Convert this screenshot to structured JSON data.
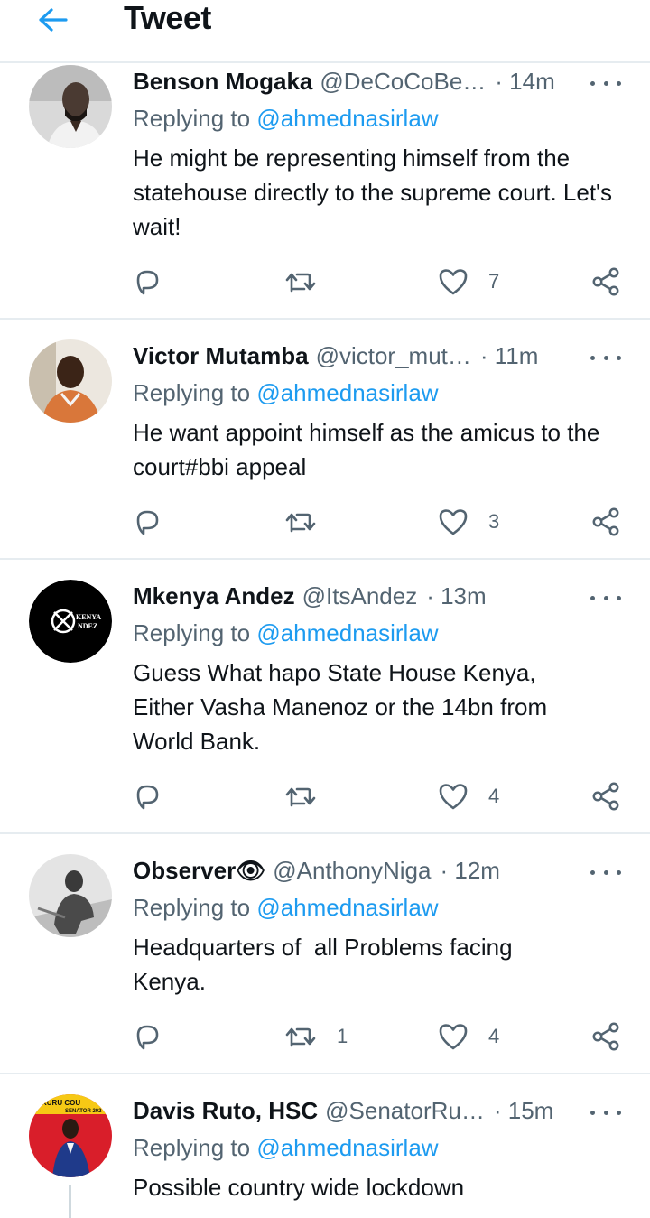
{
  "header": {
    "title": "Tweet"
  },
  "tweets": [
    {
      "name": "Benson Mogaka",
      "handle": "@DeCoCoBe…",
      "time": "· 14m",
      "replying_label": "Replying to",
      "replying_to": "@ahmednasirlaw",
      "text": "He might be representing himself from the statehouse directly to the supreme court. Let's wait!",
      "retweets": "",
      "likes": "7"
    },
    {
      "name": "Victor Mutamba",
      "handle": "@victor_mut…",
      "time": "· 11m",
      "replying_label": "Replying to",
      "replying_to": "@ahmednasirlaw",
      "text": "He want appoint himself as the amicus to the court#bbi appeal",
      "retweets": "",
      "likes": "3"
    },
    {
      "name": "Mkenya Andez",
      "handle": "@ItsAndez",
      "time": "· 13m",
      "replying_label": "Replying to",
      "replying_to": "@ahmednasirlaw",
      "text": "Guess What hapo State House Kenya, Either Vasha Manenoz or the 14bn from World Bank.",
      "retweets": "",
      "likes": "4",
      "avatar_text_1": "KENYA",
      "avatar_text_2": "NDEZ"
    },
    {
      "name": "Observer👁",
      "handle": "@AnthonyNiga",
      "time": "· 12m",
      "replying_label": "Replying to",
      "replying_to": "@ahmednasirlaw",
      "text": "Headquarters of  all Problems facing Kenya.",
      "retweets": "1",
      "likes": "4"
    },
    {
      "name": "Davis Ruto, HSC",
      "handle": "@SenatorRu…",
      "time": "· 15m",
      "replying_label": "Replying to",
      "replying_to": "@ahmednasirlaw",
      "text": "Possible country wide lockdown",
      "avatar_text_1": "KURU COU",
      "avatar_text_2": "SENATOR 202"
    }
  ],
  "colors": {
    "accent": "#1d9bf0",
    "secondary_text": "#536471",
    "divider": "#e6ecf0"
  }
}
